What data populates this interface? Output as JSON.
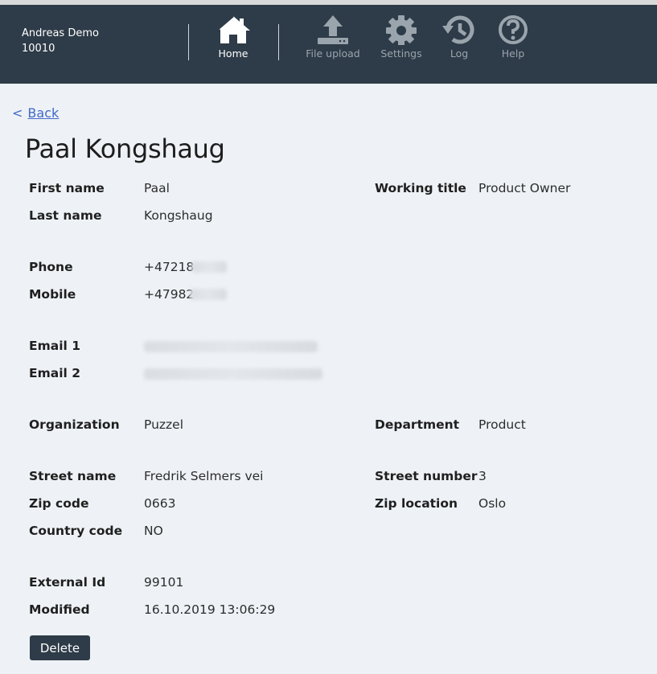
{
  "header": {
    "user_name": "Andreas Demo",
    "user_id": "10010",
    "nav": [
      {
        "label": "Home",
        "icon": "home-icon",
        "active": true
      },
      {
        "label": "File upload",
        "icon": "upload-icon",
        "active": false
      },
      {
        "label": "Settings",
        "icon": "gear-icon",
        "active": false
      },
      {
        "label": "Log",
        "icon": "history-icon",
        "active": false
      },
      {
        "label": "Help",
        "icon": "help-icon",
        "active": false
      }
    ]
  },
  "back": {
    "chevron": "<",
    "label": "Back"
  },
  "contact": {
    "name": "Paal Kongshaug",
    "fields": {
      "first_name": {
        "label": "First name",
        "value": "Paal"
      },
      "last_name": {
        "label": "Last name",
        "value": "Kongshaug"
      },
      "working_title": {
        "label": "Working title",
        "value": "Product Owner"
      },
      "phone": {
        "label": "Phone",
        "value": "+47218"
      },
      "mobile": {
        "label": "Mobile",
        "value": "+47982"
      },
      "email1": {
        "label": "Email 1",
        "value": ""
      },
      "email2": {
        "label": "Email 2",
        "value": ""
      },
      "organization": {
        "label": "Organization",
        "value": "Puzzel"
      },
      "department": {
        "label": "Department",
        "value": "Product"
      },
      "street_name": {
        "label": "Street name",
        "value": "Fredrik Selmers vei"
      },
      "street_number": {
        "label": "Street number",
        "value": "3"
      },
      "zip_code": {
        "label": "Zip code",
        "value": "0663"
      },
      "zip_location": {
        "label": "Zip location",
        "value": "Oslo"
      },
      "country_code": {
        "label": "Country code",
        "value": "NO"
      },
      "external_id": {
        "label": "External Id",
        "value": "99101"
      },
      "modified": {
        "label": "Modified",
        "value": "16.10.2019 13:06:29"
      }
    }
  },
  "actions": {
    "delete_label": "Delete"
  },
  "colors": {
    "header_bg": "#2e3b48",
    "page_bg": "#eef2f6",
    "link": "#4169c7"
  }
}
